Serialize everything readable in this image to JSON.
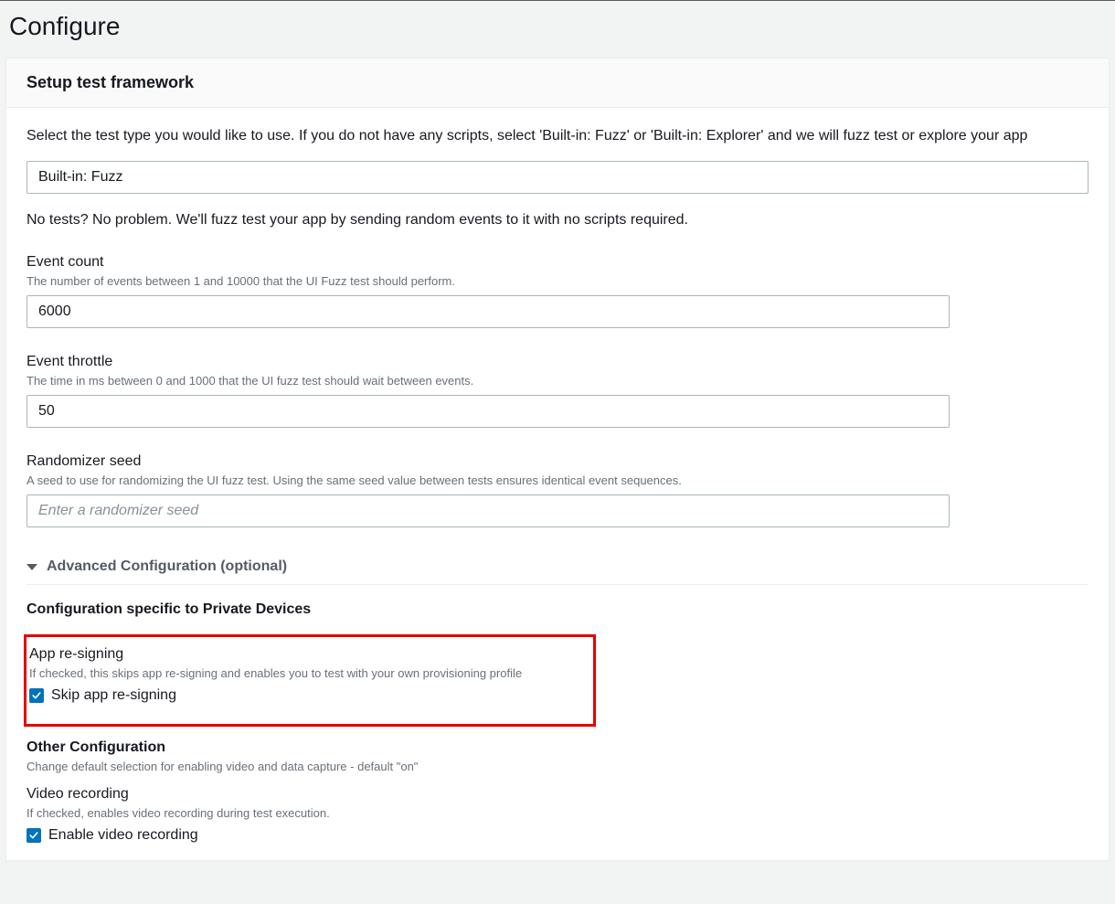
{
  "page": {
    "title": "Configure"
  },
  "panel": {
    "header": "Setup test framework",
    "intro": "Select the test type you would like to use. If you do not have any scripts, select 'Built-in: Fuzz' or 'Built-in: Explorer' and we will fuzz test or explore your app",
    "testType": {
      "selected": "Built-in: Fuzz"
    },
    "helpText": "No tests? No problem. We'll fuzz test your app by sending random events to it with no scripts required.",
    "eventCount": {
      "label": "Event count",
      "hint": "The number of events between 1 and 10000 that the UI Fuzz test should perform.",
      "value": "6000"
    },
    "eventThrottle": {
      "label": "Event throttle",
      "hint": "The time in ms between 0 and 1000 that the UI fuzz test should wait between events.",
      "value": "50"
    },
    "randomizerSeed": {
      "label": "Randomizer seed",
      "hint": "A seed to use for randomizing the UI fuzz test. Using the same seed value between tests ensures identical event sequences.",
      "placeholder": "Enter a randomizer seed",
      "value": ""
    },
    "advanced": {
      "title": "Advanced Configuration (optional)",
      "privateDevices": {
        "title": "Configuration specific to Private Devices",
        "appResigning": {
          "label": "App re-signing",
          "hint": "If checked, this skips app re-signing and enables you to test with your own provisioning profile",
          "checkboxLabel": "Skip app re-signing",
          "checked": true
        }
      },
      "otherConfig": {
        "title": "Other Configuration",
        "hint": "Change default selection for enabling video and data capture - default \"on\"",
        "videoRecording": {
          "label": "Video recording",
          "hint": "If checked, enables video recording during test execution.",
          "checkboxLabel": "Enable video recording",
          "checked": true
        }
      }
    }
  }
}
